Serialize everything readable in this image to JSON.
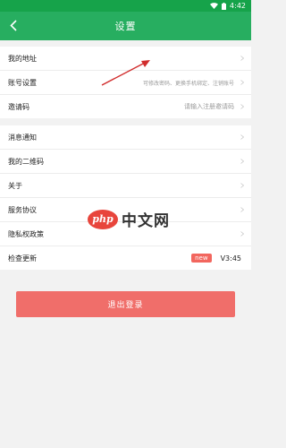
{
  "status_bar": {
    "time": "4:42"
  },
  "app_bar": {
    "title": "设置"
  },
  "group1": {
    "address": {
      "label": "我的地址"
    },
    "account": {
      "label": "账号设置",
      "hint": "可修改密码、更换手机绑定、注销账号"
    },
    "invite": {
      "label": "邀请码",
      "hint": "请输入注册邀请码"
    }
  },
  "group2": {
    "notify": {
      "label": "消息通知"
    },
    "qrcode": {
      "label": "我的二维码"
    },
    "about": {
      "label": "关于"
    },
    "service": {
      "label": "服务协议"
    },
    "privacy": {
      "label": "隐私权政策"
    },
    "update": {
      "label": "检查更新",
      "badge": "new",
      "version": "V3:45"
    }
  },
  "watermark": {
    "logo": "php",
    "text": "中文网"
  },
  "logout": {
    "label": "退出登录"
  },
  "colors": {
    "primary": "#27ae60",
    "danger": "#f06e6a"
  }
}
